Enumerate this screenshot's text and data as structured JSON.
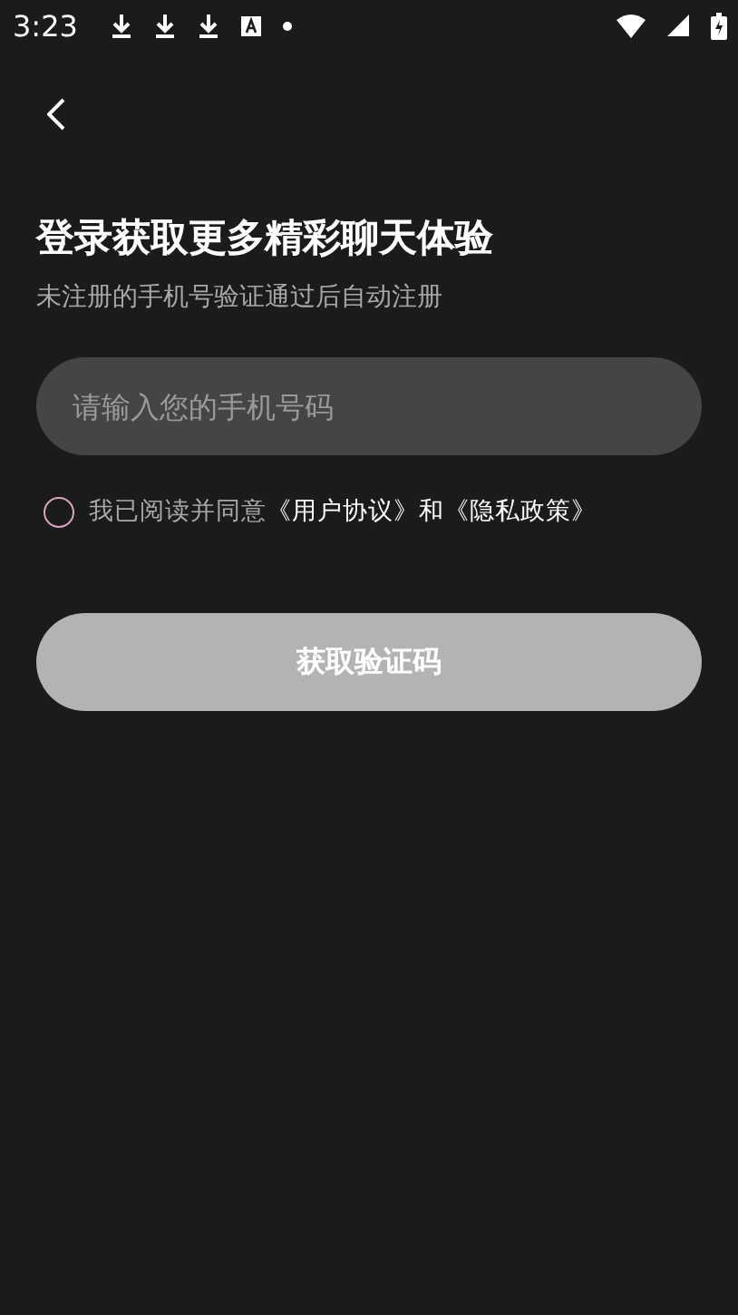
{
  "status_bar": {
    "time": "3:23"
  },
  "header": {
    "title": "登录获取更多精彩聊天体验",
    "subtitle": "未注册的手机号验证通过后自动注册"
  },
  "phone_field": {
    "placeholder": "请输入您的手机号码"
  },
  "agreement": {
    "checked": false,
    "prefix": "我已阅读并同意",
    "links": [
      "《用户协议》",
      "《隐私政策》"
    ],
    "joiner": "和"
  },
  "submit_button": {
    "label": "获取验证码",
    "disabled": true
  }
}
